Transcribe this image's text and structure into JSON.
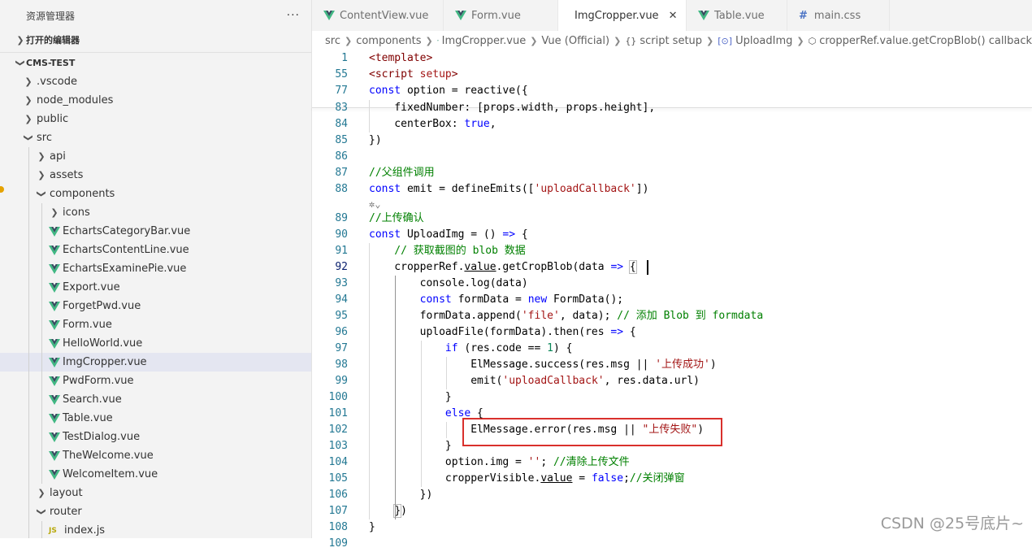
{
  "sidebar": {
    "title": "资源管理器",
    "more": "···",
    "open_editors": "打开的编辑器",
    "project": "CMS-TEST",
    "tree": [
      {
        "label": ".vscode",
        "depth": 1,
        "type": "folder-closed"
      },
      {
        "label": "node_modules",
        "depth": 1,
        "type": "folder-closed"
      },
      {
        "label": "public",
        "depth": 1,
        "type": "folder-closed"
      },
      {
        "label": "src",
        "depth": 1,
        "type": "folder-open"
      },
      {
        "label": "api",
        "depth": 2,
        "type": "folder-closed"
      },
      {
        "label": "assets",
        "depth": 2,
        "type": "folder-closed"
      },
      {
        "label": "components",
        "depth": 2,
        "type": "folder-open"
      },
      {
        "label": "icons",
        "depth": 3,
        "type": "folder-closed"
      },
      {
        "label": "EchartsCategoryBar.vue",
        "depth": 3,
        "type": "vue"
      },
      {
        "label": "EchartsContentLine.vue",
        "depth": 3,
        "type": "vue"
      },
      {
        "label": "EchartsExaminePie.vue",
        "depth": 3,
        "type": "vue"
      },
      {
        "label": "Export.vue",
        "depth": 3,
        "type": "vue"
      },
      {
        "label": "ForgetPwd.vue",
        "depth": 3,
        "type": "vue"
      },
      {
        "label": "Form.vue",
        "depth": 3,
        "type": "vue"
      },
      {
        "label": "HelloWorld.vue",
        "depth": 3,
        "type": "vue"
      },
      {
        "label": "ImgCropper.vue",
        "depth": 3,
        "type": "vue",
        "active": true
      },
      {
        "label": "PwdForm.vue",
        "depth": 3,
        "type": "vue"
      },
      {
        "label": "Search.vue",
        "depth": 3,
        "type": "vue"
      },
      {
        "label": "Table.vue",
        "depth": 3,
        "type": "vue"
      },
      {
        "label": "TestDialog.vue",
        "depth": 3,
        "type": "vue"
      },
      {
        "label": "TheWelcome.vue",
        "depth": 3,
        "type": "vue"
      },
      {
        "label": "WelcomeItem.vue",
        "depth": 3,
        "type": "vue"
      },
      {
        "label": "layout",
        "depth": 2,
        "type": "folder-closed"
      },
      {
        "label": "router",
        "depth": 2,
        "type": "folder-open"
      },
      {
        "label": "index.js",
        "depth": 3,
        "type": "js"
      }
    ]
  },
  "tabs": [
    {
      "label": "ContentView.vue",
      "type": "vue"
    },
    {
      "label": "Form.vue",
      "type": "vue"
    },
    {
      "label": "ImgCropper.vue",
      "type": "vue",
      "active": true,
      "close": "✕"
    },
    {
      "label": "Table.vue",
      "type": "vue"
    },
    {
      "label": "main.css",
      "type": "css"
    }
  ],
  "breadcrumb": [
    "src",
    "components",
    "ImgCropper.vue",
    "Vue (Official)",
    "script setup",
    "UploadImg",
    "cropperRef.value.getCropBlob() callback"
  ],
  "code": {
    "current_line": "92",
    "lines": [
      {
        "n": "1",
        "sticky": true,
        "parts": [
          [
            "tg",
            "<template>"
          ]
        ]
      },
      {
        "n": "55",
        "sticky": true,
        "parts": [
          [
            "tg",
            "<script "
          ],
          [
            "str",
            "setup"
          ],
          [
            "tg",
            ">"
          ]
        ]
      },
      {
        "n": "77",
        "sticky": true,
        "parts": [
          [
            "kw",
            "const"
          ],
          [
            "",
            " option = reactive({"
          ]
        ]
      },
      {
        "n": "83",
        "parts": [
          [
            "",
            "    fixedNumber: [props.width, props.height],"
          ]
        ]
      },
      {
        "n": "84",
        "parts": [
          [
            "",
            "    centerBox: "
          ],
          [
            "kw",
            "true"
          ],
          [
            "",
            ","
          ]
        ]
      },
      {
        "n": "85",
        "parts": [
          [
            "",
            "})"
          ]
        ]
      },
      {
        "n": "86",
        "parts": []
      },
      {
        "n": "87",
        "parts": [
          [
            "cm",
            "//父组件调用"
          ]
        ]
      },
      {
        "n": "88",
        "parts": [
          [
            "kw",
            "const"
          ],
          [
            "",
            " emit = defineEmits(["
          ],
          [
            "str",
            "'uploadCallback'"
          ],
          [
            "",
            "])"
          ]
        ]
      },
      {
        "n": "",
        "lightbulb": true,
        "parts": []
      },
      {
        "n": "89",
        "parts": [
          [
            "cm",
            "//上传确认"
          ]
        ]
      },
      {
        "n": "90",
        "parts": [
          [
            "kw",
            "const"
          ],
          [
            "",
            " UploadImg = () "
          ],
          [
            "kw",
            "=>"
          ],
          [
            "",
            " {"
          ]
        ]
      },
      {
        "n": "91",
        "parts": [
          [
            "cm",
            "    // 获取截图的 blob 数据"
          ]
        ]
      },
      {
        "n": "92",
        "parts": [
          [
            "",
            "    cropperRef."
          ],
          [
            "u",
            "value"
          ],
          [
            "",
            ".getCropBlob(data "
          ],
          [
            "kw",
            "=>"
          ],
          [
            "",
            " "
          ],
          [
            "br",
            "{"
          ]
        ]
      },
      {
        "n": "93",
        "parts": [
          [
            "",
            "        console.log(data)"
          ]
        ]
      },
      {
        "n": "94",
        "parts": [
          [
            "",
            "        "
          ],
          [
            "kw",
            "const"
          ],
          [
            "",
            " formData = "
          ],
          [
            "kw",
            "new"
          ],
          [
            "",
            " FormData();"
          ]
        ]
      },
      {
        "n": "95",
        "parts": [
          [
            "",
            "        formData.append("
          ],
          [
            "str",
            "'file'"
          ],
          [
            "",
            ", data); "
          ],
          [
            "cm",
            "// 添加 Blob 到 formdata"
          ]
        ]
      },
      {
        "n": "96",
        "parts": [
          [
            "",
            "        uploadFile(formData).then(res "
          ],
          [
            "kw",
            "=>"
          ],
          [
            "",
            " {"
          ]
        ]
      },
      {
        "n": "97",
        "parts": [
          [
            "",
            "            "
          ],
          [
            "kw",
            "if"
          ],
          [
            "",
            " (res.code == "
          ],
          [
            "num",
            "1"
          ],
          [
            "",
            ") {"
          ]
        ]
      },
      {
        "n": "98",
        "parts": [
          [
            "",
            "                ElMessage.success(res.msg || "
          ],
          [
            "str",
            "'上传成功'"
          ],
          [
            "",
            ")"
          ]
        ]
      },
      {
        "n": "99",
        "parts": [
          [
            "",
            "                emit("
          ],
          [
            "str",
            "'uploadCallback'"
          ],
          [
            "",
            ", res.data.url)"
          ]
        ]
      },
      {
        "n": "100",
        "parts": [
          [
            "",
            "            }"
          ]
        ]
      },
      {
        "n": "101",
        "parts": [
          [
            "",
            "            "
          ],
          [
            "kw",
            "else"
          ],
          [
            "",
            " {"
          ]
        ]
      },
      {
        "n": "102",
        "parts": [
          [
            "",
            "                ElMessage.error(res.msg || "
          ],
          [
            "str",
            "\"上传失败\""
          ],
          [
            "",
            ")"
          ]
        ]
      },
      {
        "n": "103",
        "parts": [
          [
            "",
            "            }"
          ]
        ]
      },
      {
        "n": "104",
        "parts": [
          [
            "",
            "            option.img = "
          ],
          [
            "str",
            "''"
          ],
          [
            "",
            "; "
          ],
          [
            "cm",
            "//清除上传文件"
          ]
        ]
      },
      {
        "n": "105",
        "parts": [
          [
            "",
            "            cropperVisible."
          ],
          [
            "u",
            "value"
          ],
          [
            "",
            " = "
          ],
          [
            "kw",
            "false"
          ],
          [
            "",
            ";"
          ],
          [
            "cm",
            "//关闭弹窗"
          ]
        ]
      },
      {
        "n": "106",
        "parts": [
          [
            "",
            "        })"
          ]
        ]
      },
      {
        "n": "107",
        "parts": [
          [
            "",
            "    "
          ],
          [
            "br",
            "}"
          ],
          [
            "",
            ")"
          ]
        ]
      },
      {
        "n": "108",
        "parts": [
          [
            "",
            "}"
          ]
        ]
      },
      {
        "n": "109",
        "parts": []
      }
    ]
  },
  "watermark": "CSDN @25号底片~",
  "colors": {
    "vue_green": "#41b883",
    "highlight_box": "#d9302c",
    "css_hash": "#4a72c4"
  }
}
